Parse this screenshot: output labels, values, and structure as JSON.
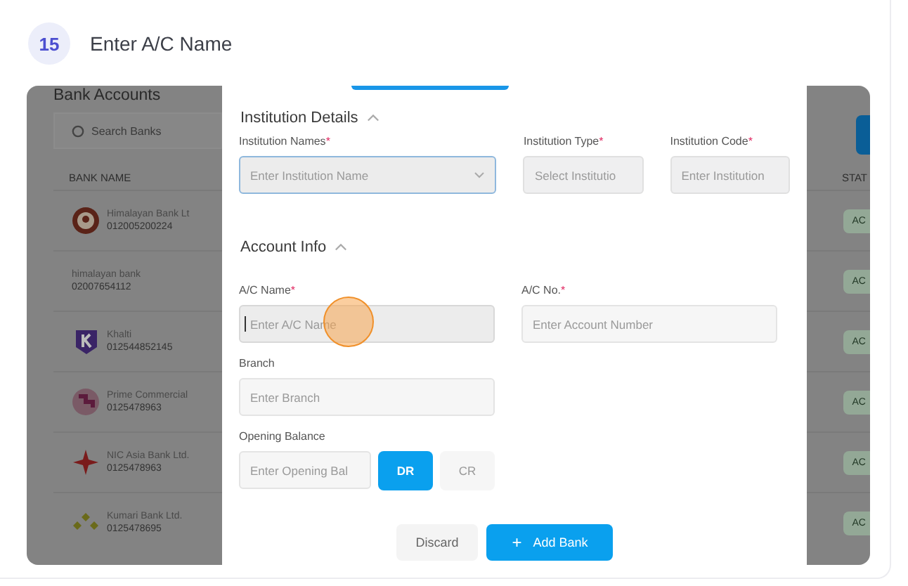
{
  "step": {
    "number": "15",
    "title": "Enter A/C Name"
  },
  "background": {
    "title": "Bank Accounts",
    "search_placeholder": "Search Banks",
    "column_1": "BANK NAME",
    "column_2": "STAT",
    "rows": [
      {
        "kind": "emblem",
        "name": "Himalayan Bank Lt",
        "account": "012005200224",
        "status": "AC"
      },
      {
        "kind": "none",
        "name": "himalayan bank",
        "account": "02007654112",
        "status": "AC"
      },
      {
        "kind": "letter",
        "name": "Khalti",
        "account": "012544852145",
        "status": "AC"
      },
      {
        "kind": "pattern",
        "name": "Prime Commercial",
        "account": "0125478963",
        "status": "AC"
      },
      {
        "kind": "star",
        "name": "NIC Asia Bank Ltd.",
        "account": "0125478963",
        "status": "AC"
      },
      {
        "kind": "diamond",
        "name": "Kumari Bank Ltd.",
        "account": "0125478695",
        "status": "AC"
      }
    ]
  },
  "modal": {
    "sections": [
      {
        "title": "Institution Details",
        "expanded": true,
        "rows": [
          [
            {
              "label": "Institution Names",
              "required_mark": "*",
              "placeholder": "Enter Institution Name",
              "kind": "select",
              "focused": true
            },
            {
              "label": "Institution Type",
              "required_mark": "*",
              "placeholder": "Select Institutio",
              "kind": "readonly",
              "focused": false
            },
            {
              "label": "Institution Code",
              "required_mark": "*",
              "placeholder": "Enter Institution",
              "kind": "readonly",
              "focused": false
            }
          ]
        ]
      },
      {
        "title": "Account Info",
        "expanded": true,
        "rows": [
          [
            {
              "label": "A/C Name",
              "required_mark": "*",
              "placeholder": "Enter A/C Name",
              "kind": "text",
              "focused": true,
              "clicked": true
            },
            {
              "label": "A/C No.",
              "required_mark": "*",
              "placeholder": "Enter Account Number",
              "kind": "text",
              "focused": false
            }
          ],
          [
            {
              "label": "Branch",
              "placeholder": "Enter Branch",
              "kind": "text",
              "focused": false
            }
          ],
          [
            {
              "label": "Opening Balance",
              "placeholder": "Enter Opening Bal",
              "kind": "balance",
              "focused": false,
              "toggles": [
                {
                  "label": "DR",
                  "selected": true
                },
                {
                  "label": "CR",
                  "selected": false
                }
              ]
            }
          ]
        ]
      }
    ],
    "buttons": [
      {
        "label": "Discard",
        "kind": "secondary"
      },
      {
        "label": "+",
        "kind": "icon"
      },
      {
        "label": "Add Bank",
        "kind": "primary"
      }
    ]
  }
}
